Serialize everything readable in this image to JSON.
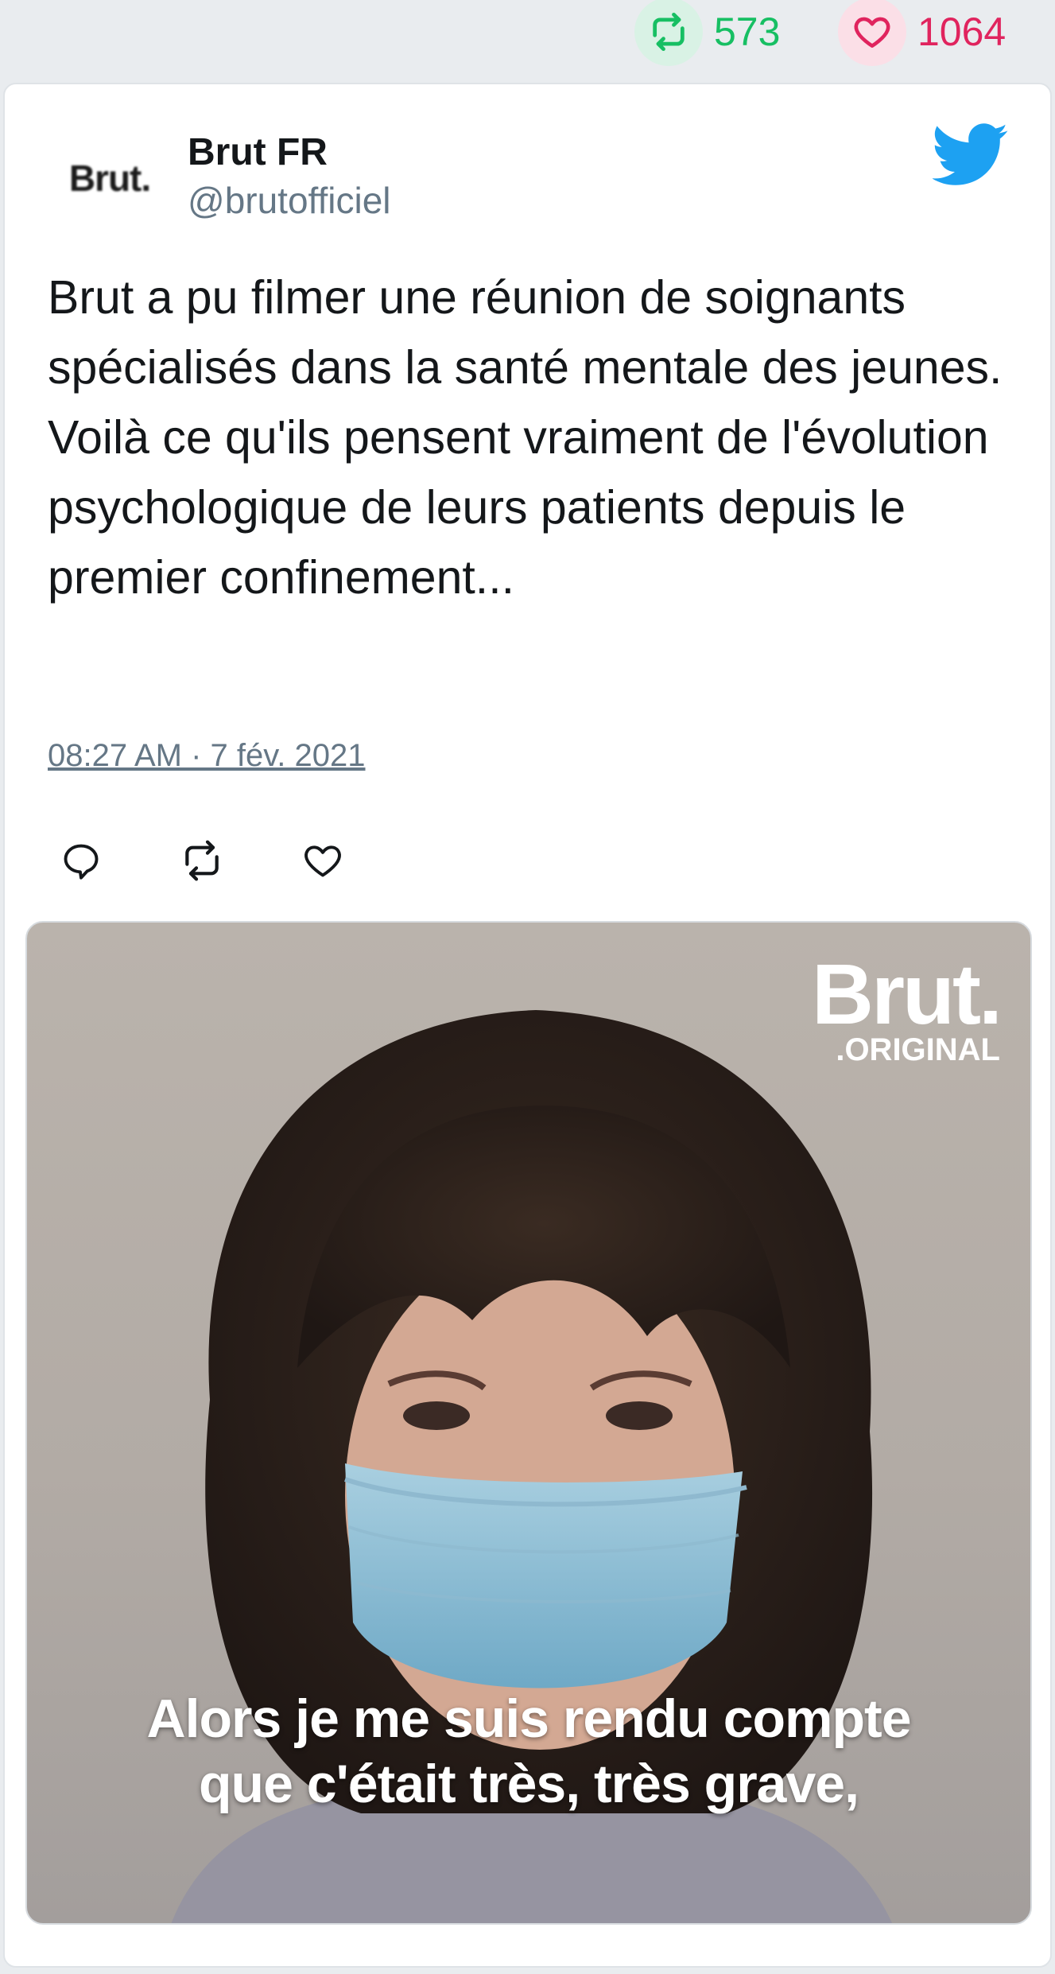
{
  "stats": {
    "retweet_count": "573",
    "like_count": "1064",
    "retweet_color": "#17bf63",
    "like_color": "#e0245e"
  },
  "tweet": {
    "author_name": "Brut FR",
    "author_handle": "@brutofficiel",
    "avatar_text": "Brut.",
    "text": "Brut a pu filmer une réunion de soignants spécialisés dans la santé mentale des jeunes. Voilà ce qu'ils pensent vraiment de l'évolution psychologique de leurs patients depuis le premier confinement...",
    "timestamp": "08:27 AM · 7 fév. 2021",
    "brand_color": "#1da1f2"
  },
  "actions": [
    {
      "icon": "reply-icon"
    },
    {
      "icon": "retweet-icon"
    },
    {
      "icon": "like-icon"
    }
  ],
  "media": {
    "watermark_main": "Brut.",
    "watermark_sub": ".ORIGINAL",
    "caption_line1": "Alors je me suis rendu compte",
    "caption_line2": "que c'était très, très grave,"
  }
}
